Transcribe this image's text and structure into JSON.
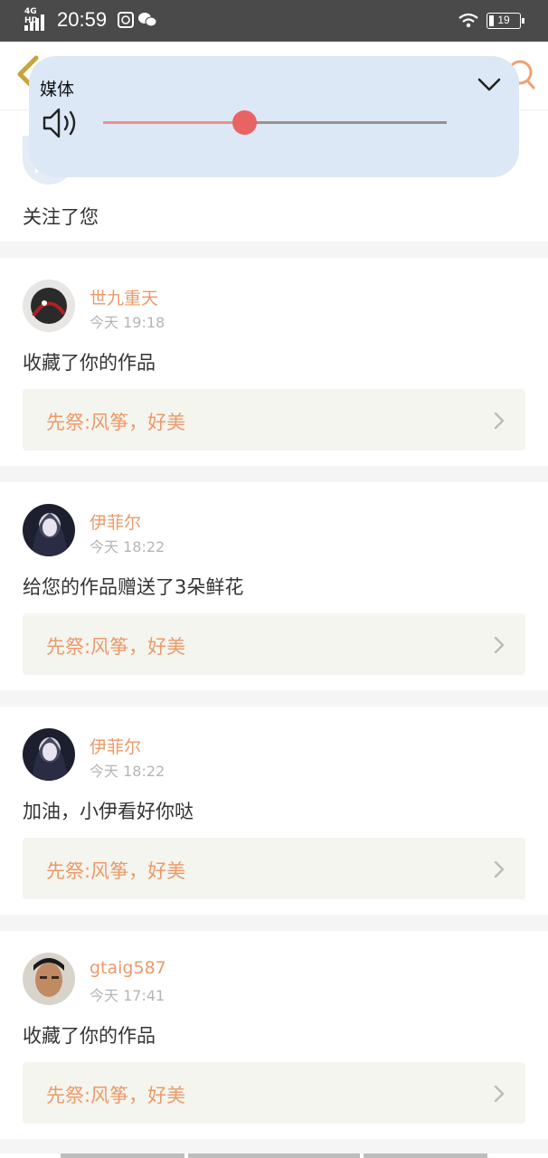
{
  "status_bar": {
    "network": "4G HD",
    "time": "20:59",
    "battery": "19",
    "icons": [
      "signal-icon",
      "app-notification-icon",
      "wechat-icon",
      "wifi-icon",
      "battery-icon"
    ]
  },
  "nav": {
    "icons": [
      "back-arrow-icon",
      "search-icon"
    ]
  },
  "media_panel": {
    "title": "媒体",
    "volume_level": 0.41,
    "icons": [
      "speaker-icon",
      "chevron-down-icon"
    ]
  },
  "first_item": {
    "action": "关注了您"
  },
  "items": [
    {
      "username": "世九重天",
      "time": "今天 19:18",
      "action": "收藏了你的作品",
      "work": "先祭:风筝，好美"
    },
    {
      "username": "伊菲尔",
      "time": "今天 18:22",
      "action": "给您的作品赠送了3朵鲜花",
      "work": "先祭:风筝，好美"
    },
    {
      "username": "伊菲尔",
      "time": "今天 18:22",
      "action": "加油，小伊看好你哒",
      "work": "先祭:风筝，好美"
    },
    {
      "username": "gtaig587",
      "time": "今天 17:41",
      "action": "收藏了你的作品",
      "work": "先祭:风筝，好美"
    }
  ],
  "colors": {
    "accent": "#eb9a6a",
    "status_bar": "#4a4a4a",
    "media_panel": "#dce8f6",
    "slider_thumb": "#e86363",
    "work_bg": "#f5f5ef",
    "separator": "#f6f5f5"
  }
}
